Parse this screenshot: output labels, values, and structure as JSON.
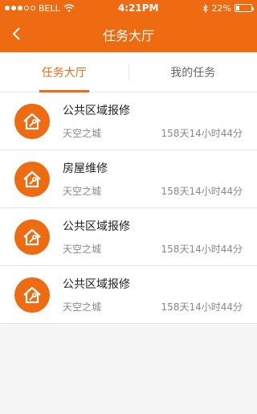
{
  "status": {
    "carrier": "BELL",
    "time": "4:21PM",
    "battery": "22%",
    "battery_level": 0.22
  },
  "header": {
    "title": "任务大厅"
  },
  "tabs": [
    {
      "label": "任务大厅"
    },
    {
      "label": "我的任务"
    }
  ],
  "tasks": [
    {
      "title": "公共区域报修",
      "location": "天空之城",
      "time_left": "158天14小时44分"
    },
    {
      "title": "房屋维修",
      "location": "天空之城",
      "time_left": "158天14小时44分"
    },
    {
      "title": "公共区域报修",
      "location": "天空之城",
      "time_left": "158天14小时44分"
    },
    {
      "title": "公共区域报修",
      "location": "天空之城",
      "time_left": "158天14小时44分"
    }
  ],
  "icons": {
    "status_signal": "signal-dots-icon",
    "status_wifi": "wifi-icon",
    "status_bluetooth": "bluetooth-icon",
    "status_battery": "battery-icon",
    "back": "chevron-left-icon",
    "task": "house-repair-icon"
  },
  "colors": {
    "accent": "#ee6b12",
    "text": "#222222",
    "muted": "#888888"
  }
}
